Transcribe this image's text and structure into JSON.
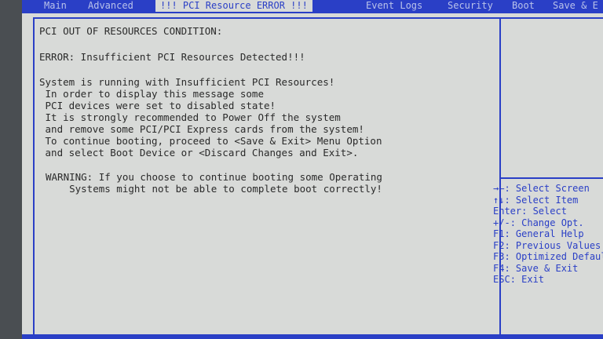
{
  "menubar": {
    "tabs": [
      {
        "label": "Main",
        "active": false
      },
      {
        "label": "Advanced",
        "active": false
      },
      {
        "label": "!!! PCI Resource ERROR !!!",
        "active": true
      },
      {
        "label": "Event Logs",
        "active": false
      },
      {
        "label": "Security",
        "active": false
      },
      {
        "label": "Boot",
        "active": false
      },
      {
        "label": "Save & E",
        "active": false
      }
    ]
  },
  "message": {
    "heading": "PCI OUT OF RESOURCES CONDITION:",
    "error": "ERROR: Insufficient PCI Resources Detected!!!",
    "body": [
      "System is running with Insufficient PCI Resources!",
      " In order to display this message some",
      " PCI devices were set to disabled state!",
      " It is strongly recommended to Power Off the system",
      " and remove some PCI/PCI Express cards from the system!",
      " To continue booting, proceed to <Save & Exit> Menu Option",
      " and select Boot Device or <Discard Changes and Exit>."
    ],
    "warning": [
      "WARNING: If you choose to continue booting some Operating",
      "    Systems might not be able to complete boot correctly!"
    ]
  },
  "help": [
    {
      "key": "→←",
      "text": ": Select Screen"
    },
    {
      "key": "↑↓",
      "text": ": Select Item"
    },
    {
      "key": "Enter",
      "text": ": Select"
    },
    {
      "key": "+/-",
      "text": ": Change Opt."
    },
    {
      "key": "F1",
      "text": ": General Help"
    },
    {
      "key": "F2",
      "text": ": Previous Values"
    },
    {
      "key": "F3",
      "text": ": Optimized Defaults"
    },
    {
      "key": "F4",
      "text": ": Save & Exit"
    },
    {
      "key": "ESC",
      "text": ": Exit"
    }
  ],
  "colors": {
    "accent_blue": "#2a3fc6",
    "screen_bg": "#d8dad8",
    "text": "#2a2a2a"
  }
}
